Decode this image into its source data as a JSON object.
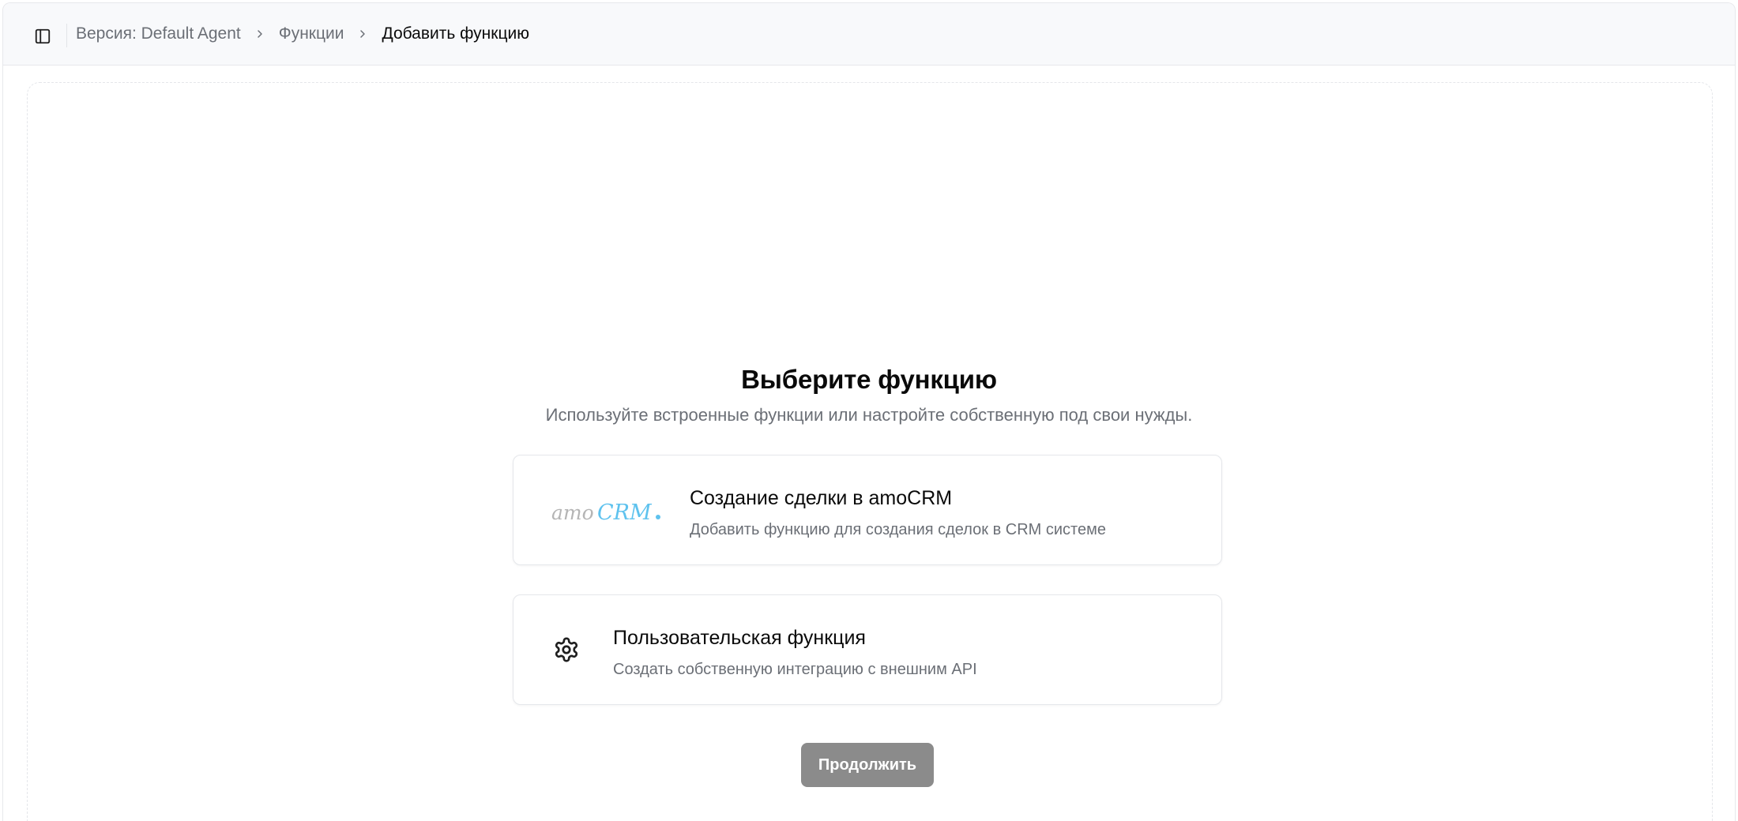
{
  "breadcrumb": {
    "items": [
      {
        "label": "Версия: Default Agent"
      },
      {
        "label": "Функции"
      },
      {
        "label": "Добавить функцию"
      }
    ]
  },
  "main": {
    "title": "Выберите функцию",
    "subtitle": "Используйте встроенные функции или настройте собственную под свои нужды.",
    "options": [
      {
        "logo": "amoCRM.",
        "icon": "amocrm-logo",
        "title": "Создание сделки в amoCRM",
        "description": "Добавить функцию для создания сделок в CRM системе"
      },
      {
        "icon": "gear-icon",
        "title": "Пользовательская функция",
        "description": "Создать собственную интеграцию с внешним API"
      }
    ],
    "continue_label": "Продолжить"
  },
  "colors": {
    "header_bg": "#f8f9fb",
    "muted_text": "#6b6f76",
    "button_disabled": "#8b8b8b",
    "amocrm_gray": "#b5b5b5",
    "amocrm_blue": "#5ec2ee"
  }
}
